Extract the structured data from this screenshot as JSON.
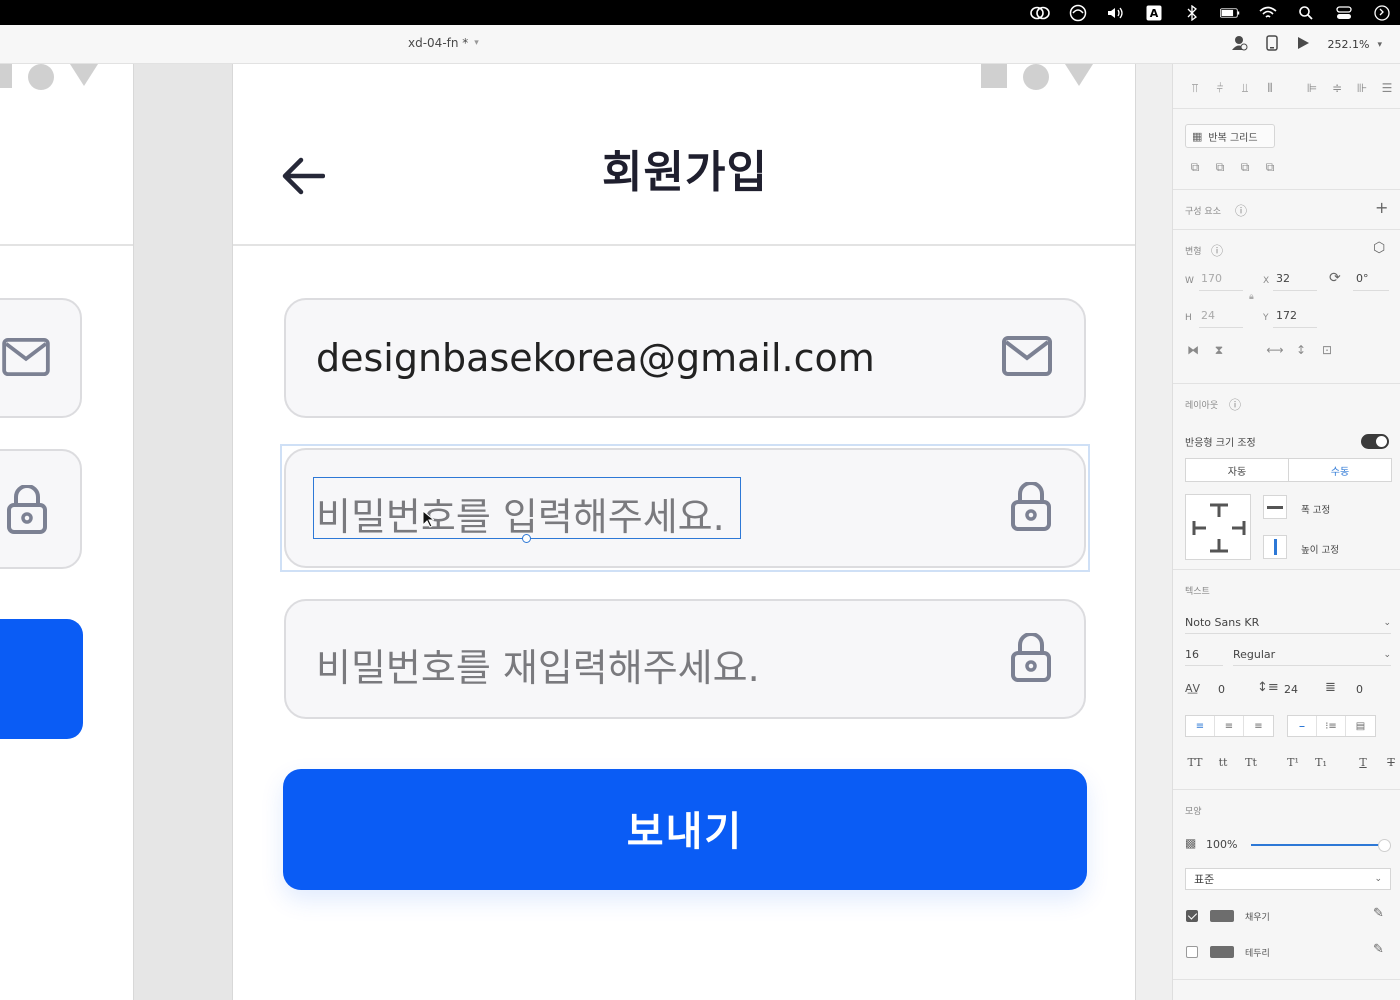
{
  "document": {
    "title": "xd-04-fn *"
  },
  "toolbar": {
    "zoom": "252.1%"
  },
  "artboard": {
    "title": "회원가입",
    "email_value": "designbasekorea@gmail.com",
    "password_placeholder": "비밀번호를 입력해주세요.",
    "password_confirm_placeholder": "비밀번호를 재입력해주세요.",
    "submit_label": "보내기"
  },
  "panel": {
    "repeat_grid": "반복 그리드",
    "components_label": "구성 요소",
    "transform_label": "변형",
    "transform": {
      "w": "170",
      "h": "24",
      "x": "32",
      "y": "172",
      "rotation": "0°"
    },
    "layout_label": "레이아웃",
    "responsive_resize": "반응형 크기 조정",
    "responsive_auto": "자동",
    "responsive_manual": "수동",
    "fix_width": "폭 고정",
    "fix_height": "높이 고정",
    "text_label": "텍스트",
    "font_family": "Noto Sans KR",
    "font_size": "16",
    "font_weight": "Regular",
    "char_spacing": "0",
    "line_spacing": "24",
    "paragraph_spacing": "0",
    "appearance_label": "모양",
    "opacity": "100%",
    "blend_mode": "표준",
    "fill_label": "채우기",
    "border_label": "테두리",
    "fill_checked": true,
    "border_checked": false
  },
  "colors": {
    "primary": "#0A5CF5",
    "selection": "#2D78D6",
    "fill_swatch": "#6D6D6D"
  },
  "icons": [
    "adobe-cc-icon",
    "sync-icon",
    "volume-icon",
    "input-source-icon",
    "bluetooth-icon",
    "battery-icon",
    "wifi-icon",
    "spotlight-icon",
    "control-center-icon",
    "siri-icon",
    "share-user-icon",
    "device-preview-icon",
    "play-icon",
    "mail-icon",
    "lock-icon",
    "arrow-left-icon"
  ]
}
